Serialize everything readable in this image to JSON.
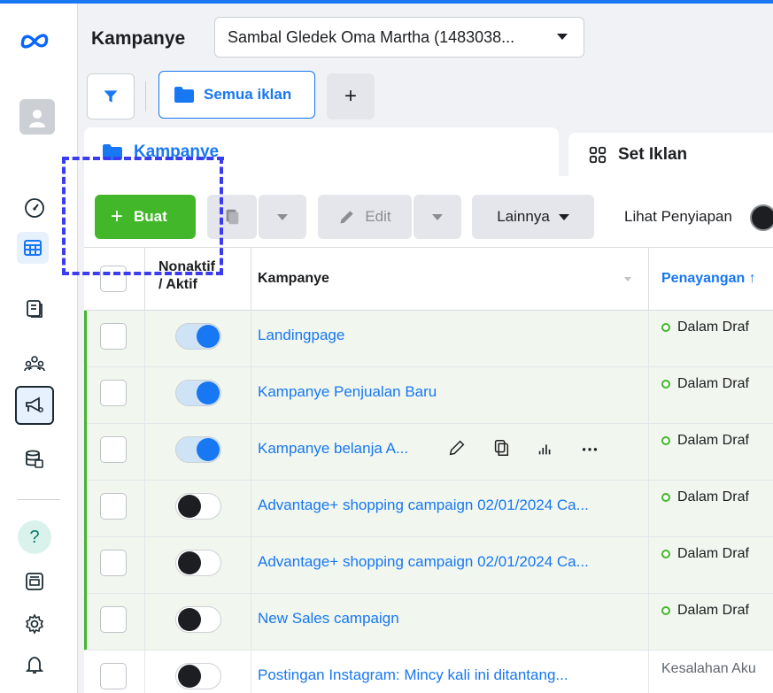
{
  "header": {
    "title": "Kampanye",
    "account_selector": "Sambal Gledek Oma Martha (1483038..."
  },
  "filters": {
    "all_ads_label": "Semua iklan",
    "add_label": "+"
  },
  "tabs": [
    {
      "label": "Kampanye",
      "active": true
    },
    {
      "label": "Set Iklan",
      "active": false
    }
  ],
  "toolbar": {
    "create_label": "Buat",
    "edit_label": "Edit",
    "more_label": "Lainnya",
    "view_setup_label": "Lihat Penyiapan"
  },
  "table": {
    "headers": {
      "toggle": "Nonaktif / Aktif",
      "toggle_line1": "Nonaktif",
      "toggle_line2": "/ Aktif",
      "campaign": "Kampanye",
      "delivery": "Penayangan ↑"
    },
    "rows": [
      {
        "name": "Landingpage",
        "active": true,
        "status": "Dalam Draf"
      },
      {
        "name": "Kampanye Penjualan Baru",
        "active": true,
        "status": "Dalam Draf"
      },
      {
        "name": "Kampanye belanja A...",
        "active": true,
        "status": "Dalam Draf"
      },
      {
        "name": "Advantage+ shopping campaign 02/01/2024 Ca...",
        "active": false,
        "status": "Dalam Draf"
      },
      {
        "name": "Advantage+ shopping campaign 02/01/2024 Ca...",
        "active": false,
        "status": "Dalam Draf"
      },
      {
        "name": "New Sales campaign",
        "active": false,
        "status": "Dalam Draf"
      },
      {
        "name": "Postingan Instagram: Mincy kali ini ditantang...",
        "active": false,
        "status": "Kesalahan Aku"
      }
    ]
  },
  "colors": {
    "accent": "#1877f2",
    "create_button": "#42b72a",
    "draft_row_bg": "#f1f7ee",
    "annotation_dash": "#3b3bf0"
  }
}
